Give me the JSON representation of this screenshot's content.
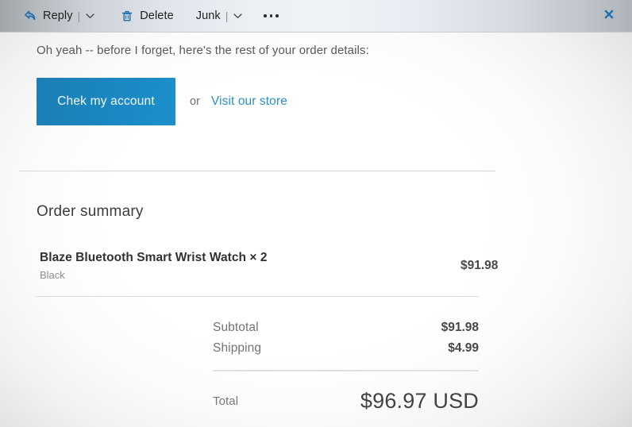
{
  "toolbar": {
    "reply": {
      "label": "Reply",
      "icon": "reply-arrow-icon",
      "separator": "|",
      "caret": "chevron-down-icon"
    },
    "delete": {
      "label": "Delete",
      "icon": "trash-icon"
    },
    "junk": {
      "label": "Junk",
      "separator": "|",
      "caret": "chevron-down-icon"
    },
    "more": {
      "name": "more-options-ellipsis"
    },
    "close": {
      "label": "✕"
    },
    "accent_color": "#1b6eb0"
  },
  "message": {
    "intro_text": "Oh yeah -- before I forget, here's the rest of your order details:"
  },
  "cta": {
    "button_label": "Chek my account",
    "or_text": "or",
    "link_label": "Visit our store",
    "button_color_start": "#1b7fb4",
    "button_color_end": "#1c90cc",
    "link_color": "#2a92c8"
  },
  "order_summary": {
    "title": "Order summary",
    "items": [
      {
        "name": "Blaze Bluetooth Smart Wrist Watch × 2",
        "variant": "Black",
        "price": "$91.98"
      }
    ],
    "totals": [
      {
        "label": "Subtotal",
        "value": "$91.98"
      },
      {
        "label": "Shipping",
        "value": "$4.99"
      }
    ],
    "grand_total": {
      "label": "Total",
      "value": "$96.97 USD"
    }
  }
}
